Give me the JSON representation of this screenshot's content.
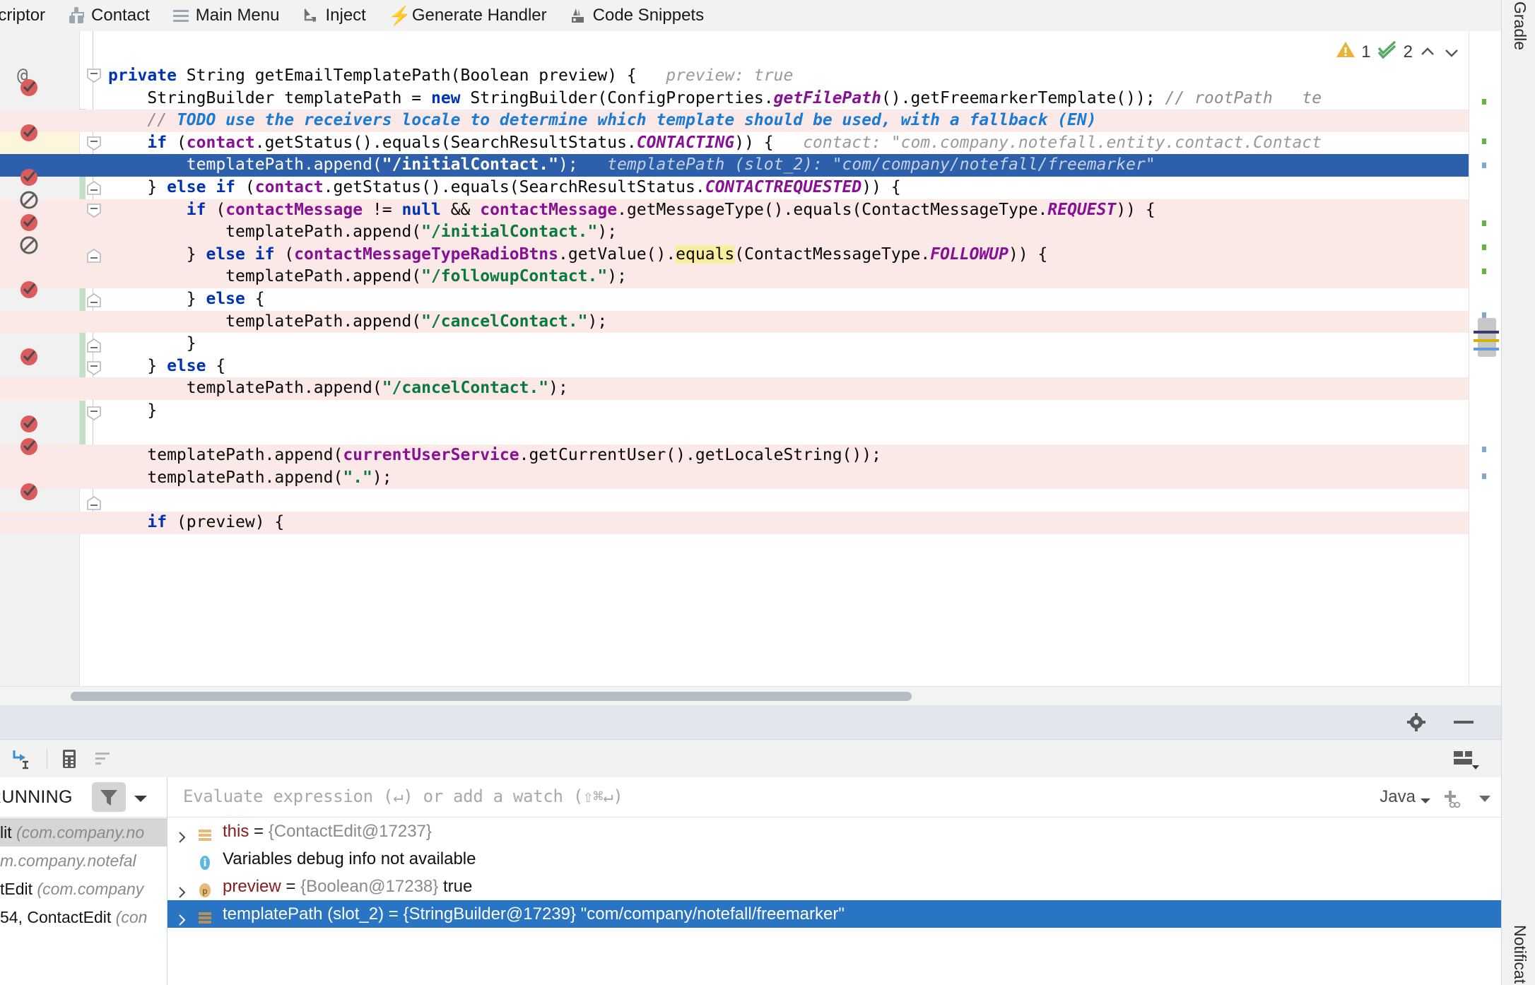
{
  "toolbar": {
    "items": [
      {
        "label": "escriptor",
        "icon": "none"
      },
      {
        "label": "Contact",
        "icon": "contact-icon"
      },
      {
        "label": "Main Menu",
        "icon": "hamburger-icon"
      },
      {
        "label": "Inject",
        "icon": "inject-arrow-icon"
      },
      {
        "label": "Generate Handler",
        "icon": "lightning-icon"
      },
      {
        "label": "Code Snippets",
        "icon": "code-snippets-icon"
      }
    ]
  },
  "editor": {
    "inspections": {
      "warning_count": "1",
      "ok_count": "2",
      "up": "⌃",
      "down": "⌄"
    },
    "gutter_at": "@",
    "lines": [
      {
        "n": 0,
        "bg": "none",
        "segs": [
          {
            "t": "private ",
            "c": "kw"
          },
          {
            "t": "String getEmailTemplatePath(Boolean preview) {",
            "c": "pln"
          },
          {
            "t": "   preview: true",
            "c": "hint"
          }
        ]
      },
      {
        "n": 1,
        "bg": "none",
        "segs": [
          {
            "t": "    StringBuilder templatePath = ",
            "c": "pln"
          },
          {
            "t": "new",
            "c": "kw"
          },
          {
            "t": " StringBuilder(ConfigProperties.",
            "c": "pln"
          },
          {
            "t": "getFilePath",
            "c": "stc"
          },
          {
            "t": "().getFreemarkerTemplate());",
            "c": "pln"
          },
          {
            "t": " // rootPath   te",
            "c": "cmt"
          }
        ]
      },
      {
        "n": 2,
        "bg": "pink",
        "segs": [
          {
            "t": "    // ",
            "c": "cmt"
          },
          {
            "t": "TODO use the receivers locale to determine which template should be used, with a fallback (EN)",
            "c": "todo"
          }
        ]
      },
      {
        "n": 3,
        "bg": "none",
        "segs": [
          {
            "t": "    ",
            "c": "pln"
          },
          {
            "t": "if",
            "c": "kw"
          },
          {
            "t": " (",
            "c": "pln"
          },
          {
            "t": "contact",
            "c": "fld"
          },
          {
            "t": ".getStatus().equals(SearchResultStatus.",
            "c": "pln"
          },
          {
            "t": "CONTACTING",
            "c": "stc"
          },
          {
            "t": ")) {",
            "c": "pln"
          },
          {
            "t": "   contact: \"com.company.notefall.entity.contact.Contact",
            "c": "hint"
          }
        ]
      },
      {
        "n": 4,
        "bg": "sel",
        "segs": [
          {
            "t": "        templatePath.append(",
            "c": "pln"
          },
          {
            "t": "\"/initialContact.\"",
            "c": "str"
          },
          {
            "t": ");",
            "c": "pln"
          },
          {
            "t": "   templatePath (slot_2): \"com/company/notefall/freemarker\"",
            "c": "hint"
          }
        ]
      },
      {
        "n": 5,
        "bg": "none",
        "segs": [
          {
            "t": "    } ",
            "c": "pln"
          },
          {
            "t": "else if",
            "c": "kw"
          },
          {
            "t": " (",
            "c": "pln"
          },
          {
            "t": "contact",
            "c": "fld"
          },
          {
            "t": ".getStatus().equals(SearchResultStatus.",
            "c": "pln"
          },
          {
            "t": "CONTACTREQUESTED",
            "c": "stc"
          },
          {
            "t": ")) {",
            "c": "pln"
          }
        ]
      },
      {
        "n": 6,
        "bg": "pink",
        "segs": [
          {
            "t": "        ",
            "c": "pln"
          },
          {
            "t": "if",
            "c": "kw"
          },
          {
            "t": " (",
            "c": "pln"
          },
          {
            "t": "contactMessage",
            "c": "fld"
          },
          {
            "t": " != ",
            "c": "pln"
          },
          {
            "t": "null",
            "c": "kw"
          },
          {
            "t": " && ",
            "c": "pln"
          },
          {
            "t": "contactMessage",
            "c": "fld"
          },
          {
            "t": ".getMessageType().equals(ContactMessageType.",
            "c": "pln"
          },
          {
            "t": "REQUEST",
            "c": "stc"
          },
          {
            "t": ")) {",
            "c": "pln"
          }
        ]
      },
      {
        "n": 7,
        "bg": "pink",
        "segs": [
          {
            "t": "            templatePath.append(",
            "c": "pln"
          },
          {
            "t": "\"/initialContact.\"",
            "c": "str"
          },
          {
            "t": ");",
            "c": "pln"
          }
        ]
      },
      {
        "n": 8,
        "bg": "pink",
        "segs": [
          {
            "t": "        } ",
            "c": "pln"
          },
          {
            "t": "else if",
            "c": "kw"
          },
          {
            "t": " (",
            "c": "pln"
          },
          {
            "t": "contactMessageTypeRadioBtns",
            "c": "fld"
          },
          {
            "t": ".getValue().",
            "c": "pln"
          },
          {
            "t": "equals",
            "c": "pln hl"
          },
          {
            "t": "(ContactMessageType.",
            "c": "pln"
          },
          {
            "t": "FOLLOWUP",
            "c": "stc"
          },
          {
            "t": ")) {",
            "c": "pln"
          }
        ]
      },
      {
        "n": 9,
        "bg": "pink",
        "segs": [
          {
            "t": "            templatePath.append(",
            "c": "pln"
          },
          {
            "t": "\"/followupContact.\"",
            "c": "str"
          },
          {
            "t": ");",
            "c": "pln"
          }
        ]
      },
      {
        "n": 10,
        "bg": "none",
        "segs": [
          {
            "t": "        } ",
            "c": "pln"
          },
          {
            "t": "else",
            "c": "kw"
          },
          {
            "t": " {",
            "c": "pln"
          }
        ]
      },
      {
        "n": 11,
        "bg": "pink",
        "segs": [
          {
            "t": "            templatePath.append(",
            "c": "pln"
          },
          {
            "t": "\"/cancelContact.\"",
            "c": "str"
          },
          {
            "t": ");",
            "c": "pln"
          }
        ]
      },
      {
        "n": 12,
        "bg": "none",
        "segs": [
          {
            "t": "        }",
            "c": "pln"
          }
        ]
      },
      {
        "n": 13,
        "bg": "none",
        "segs": [
          {
            "t": "    } ",
            "c": "pln"
          },
          {
            "t": "else",
            "c": "kw"
          },
          {
            "t": " {",
            "c": "pln"
          }
        ]
      },
      {
        "n": 14,
        "bg": "pink",
        "segs": [
          {
            "t": "        templatePath.append(",
            "c": "pln"
          },
          {
            "t": "\"/cancelContact.\"",
            "c": "str"
          },
          {
            "t": ");",
            "c": "pln"
          }
        ]
      },
      {
        "n": 15,
        "bg": "none",
        "segs": [
          {
            "t": "    }",
            "c": "pln"
          }
        ]
      },
      {
        "n": 16,
        "bg": "none",
        "segs": [
          {
            "t": "",
            "c": "pln"
          }
        ]
      },
      {
        "n": 17,
        "bg": "pink",
        "segs": [
          {
            "t": "    templatePath.append(",
            "c": "pln"
          },
          {
            "t": "currentUserService",
            "c": "fld"
          },
          {
            "t": ".getCurrentUser().getLocaleString());",
            "c": "pln"
          }
        ]
      },
      {
        "n": 18,
        "bg": "pink",
        "segs": [
          {
            "t": "    templatePath.append(",
            "c": "pln"
          },
          {
            "t": "\".\"",
            "c": "str"
          },
          {
            "t": ");",
            "c": "pln"
          }
        ]
      },
      {
        "n": 19,
        "bg": "none",
        "segs": [
          {
            "t": "",
            "c": "pln"
          }
        ]
      },
      {
        "n": 20,
        "bg": "pink",
        "segs": [
          {
            "t": "    ",
            "c": "pln"
          },
          {
            "t": "if",
            "c": "kw"
          },
          {
            "t": " (preview) {",
            "c": "pln"
          }
        ]
      }
    ]
  },
  "debugger": {
    "gear_icon": "gear-icon",
    "minimize_icon": "minimize-icon",
    "tools": [
      "step-out-icon",
      "calculator-icon",
      "sort-icon"
    ],
    "layout_icon": "layout-settings-icon",
    "frames": {
      "status": "RUNNING",
      "filter_icon": "filter-icon",
      "dropdown_icon": "chevron-down-icon",
      "rows": [
        {
          "name": "lit",
          "pkg": "(com.company.no",
          "selected": true
        },
        {
          "name": "",
          "pkg": "m.company.notefal",
          "selected": false
        },
        {
          "name": "tEdit",
          "pkg": "(com.company",
          "selected": false
        },
        {
          "name": "54, ContactEdit",
          "pkg": "(con",
          "selected": false
        }
      ]
    },
    "watches": {
      "placeholder": "Evaluate expression (↵) or add a watch (⇧⌘↵)",
      "language": "Java",
      "language_caret": "chevron-down-icon",
      "add_watch_icon": "add-watch-icon",
      "more_icon": "chevron-down-icon"
    },
    "variables": [
      {
        "expand": true,
        "icon": "field-icon",
        "name": "this",
        "eq": " = ",
        "value": "{ContactEdit@17237}",
        "tail": "",
        "selected": false,
        "kind": "var"
      },
      {
        "expand": false,
        "icon": "info-icon",
        "name": "",
        "eq": "",
        "value": "",
        "tail": "Variables debug info not available",
        "selected": false,
        "kind": "info"
      },
      {
        "expand": true,
        "icon": "param-icon",
        "name": "preview",
        "eq": " = ",
        "value": "{Boolean@17238}",
        "tail": " true",
        "selected": false,
        "kind": "var"
      },
      {
        "expand": true,
        "icon": "field-icon",
        "name": "templatePath (slot_2)",
        "eq": " = ",
        "value": "{StringBuilder@17239}",
        "tail": " \"com/company/notefall/freemarker\"",
        "selected": true,
        "kind": "var"
      }
    ]
  },
  "right_strip": {
    "top_label": "Gradle",
    "bottom_label": "Notificat"
  },
  "colors": {
    "selection": "#2e5faa",
    "pink": "#fbe9e7",
    "accent_blue": "#2a74c4",
    "warning": "#e8b339",
    "ok": "#59a869"
  }
}
